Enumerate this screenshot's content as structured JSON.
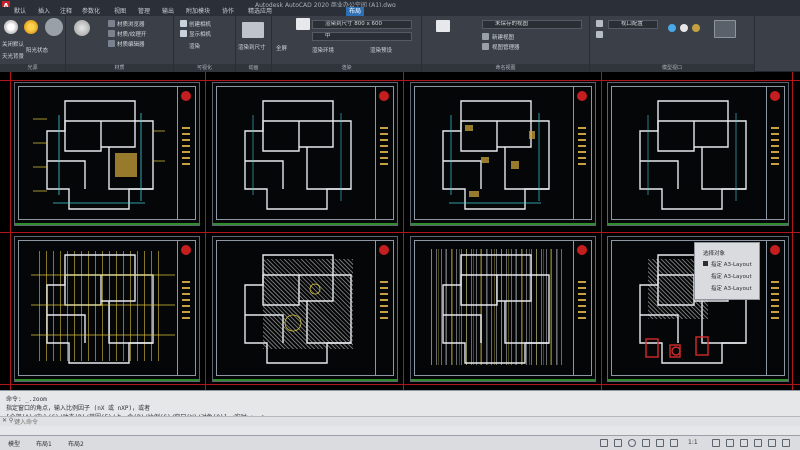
{
  "window": {
    "title": "Autodesk AutoCAD 2020   商业办公空间 (A1).dwg"
  },
  "menu": {
    "items": [
      {
        "label": "默认",
        "active": false
      },
      {
        "label": "插入",
        "active": false
      },
      {
        "label": "注释",
        "active": false
      },
      {
        "label": "参数化",
        "active": false
      },
      {
        "label": "视图",
        "active": false
      },
      {
        "label": "管理",
        "active": false
      },
      {
        "label": "输出",
        "active": false
      },
      {
        "label": "附加模块",
        "active": false
      },
      {
        "label": "协作",
        "active": false
      },
      {
        "label": "精选应用",
        "active": false
      },
      {
        "label": "布局",
        "active": true
      }
    ]
  },
  "ribbon": {
    "panels": [
      {
        "title": "光源",
        "labels": [
          "关闭默认",
          "阳光状态",
          "天光背景"
        ]
      },
      {
        "title": "材质",
        "labels": [
          "材质浏览器",
          "材质/纹理开",
          "材质编辑器"
        ]
      },
      {
        "title": "可视化",
        "labels": [
          "创建相机",
          "显示相机",
          "渲染"
        ]
      },
      {
        "title": "动画",
        "labels": [
          "渲染到尺寸"
        ]
      },
      {
        "title": "渲染",
        "labels": [
          "全屏",
          "渲染环境",
          "渲染预设"
        ]
      },
      {
        "title": "命名视图",
        "labels": [
          "未保存的视图",
          "新建视图",
          "视图管理器"
        ]
      },
      {
        "title": "模型视口",
        "labels": [
          "视口配置"
        ]
      }
    ],
    "render_size_field": "渲染到尺寸 800 x 600",
    "render_preset_field": "中"
  },
  "drawing": {
    "viewport_count": 8
  },
  "popup": {
    "title": "选择对象",
    "items": [
      "指定 A3-Layout",
      "指定 A3-Layout",
      "指定 A3-Layout"
    ]
  },
  "command": {
    "lines": [
      "命令: _.zoom",
      "指定窗口的角点，输入比例因子 (nX 或 nXP)，或者",
      "[全部(A)/中心(C)/动态(D)/范围(E)/上一个(P)/比例(S)/窗口(W)/对象(O)] <实时>: _e"
    ],
    "prompt_symbol": "✕ ⚲",
    "input_placeholder": "键入命令"
  },
  "statusbar": {
    "left_tabs": [
      "模型",
      "布局1",
      "布局2"
    ],
    "scale": "1:1"
  },
  "colors": {
    "accent": "#2d6fb5",
    "wall": "#e6e9ee",
    "cyan": "#3fd0e0",
    "yellow": "#d8c23a",
    "green": "#36b04a",
    "red": "#d42a2a",
    "gridline": "#b0151b"
  }
}
